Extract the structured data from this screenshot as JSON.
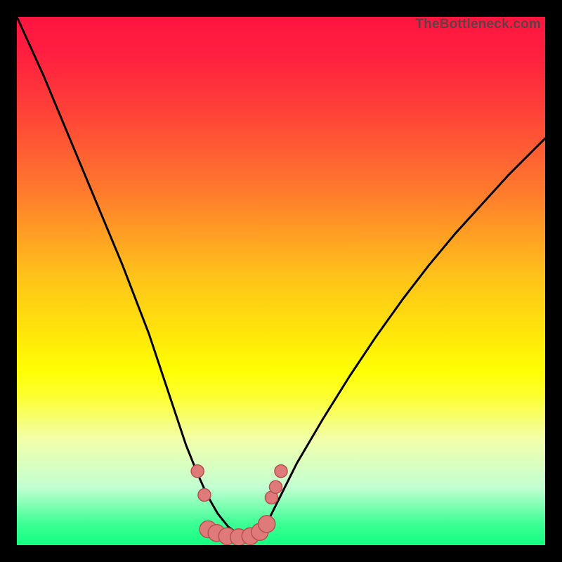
{
  "watermark": "TheBottleneck.com",
  "colors": {
    "frame_border": "#000000",
    "curve": "#000000",
    "marker_fill": "#df7a7a",
    "marker_stroke": "#b94f4f",
    "gradient_top": "#ff153f",
    "gradient_bottom": "#14ff80"
  },
  "chart_data": {
    "type": "line",
    "title": "",
    "xlabel": "",
    "ylabel": "",
    "xlim": [
      0,
      100
    ],
    "ylim": [
      0,
      100
    ],
    "grid": false,
    "series": [
      {
        "name": "left_curve",
        "x": [
          0,
          5,
          10,
          15,
          20,
          25,
          28,
          30,
          32,
          34,
          36,
          38,
          40,
          42,
          44
        ],
        "values": [
          100,
          89,
          77,
          65,
          53,
          40,
          31,
          25,
          19,
          14,
          9.5,
          6,
          3.5,
          2,
          1.5
        ]
      },
      {
        "name": "valley_floor",
        "x": [
          36,
          38,
          40,
          42,
          44,
          46,
          48
        ],
        "values": [
          3,
          2.3,
          1.7,
          1.5,
          1.7,
          2.5,
          4
        ]
      },
      {
        "name": "right_curve",
        "x": [
          44,
          46,
          48,
          50,
          53,
          58,
          63,
          68,
          73,
          78,
          83,
          88,
          93,
          98,
          100
        ],
        "values": [
          1.5,
          2.5,
          5.5,
          9.5,
          15.5,
          24,
          32,
          39.5,
          46.5,
          53,
          59,
          64.5,
          70,
          75,
          77
        ]
      }
    ],
    "markers": [
      {
        "x": 34.2,
        "y": 14.0,
        "r": 1.2
      },
      {
        "x": 35.5,
        "y": 9.5,
        "r": 1.2
      },
      {
        "x": 36.2,
        "y": 3.0,
        "r": 1.6
      },
      {
        "x": 37.8,
        "y": 2.3,
        "r": 1.6
      },
      {
        "x": 39.8,
        "y": 1.7,
        "r": 1.6
      },
      {
        "x": 42.0,
        "y": 1.5,
        "r": 1.6
      },
      {
        "x": 44.2,
        "y": 1.7,
        "r": 1.6
      },
      {
        "x": 46.0,
        "y": 2.5,
        "r": 1.6
      },
      {
        "x": 47.3,
        "y": 4.0,
        "r": 1.6
      },
      {
        "x": 48.2,
        "y": 9.0,
        "r": 1.2
      },
      {
        "x": 49.0,
        "y": 11.0,
        "r": 1.2
      },
      {
        "x": 50.0,
        "y": 14.0,
        "r": 1.2
      }
    ]
  }
}
